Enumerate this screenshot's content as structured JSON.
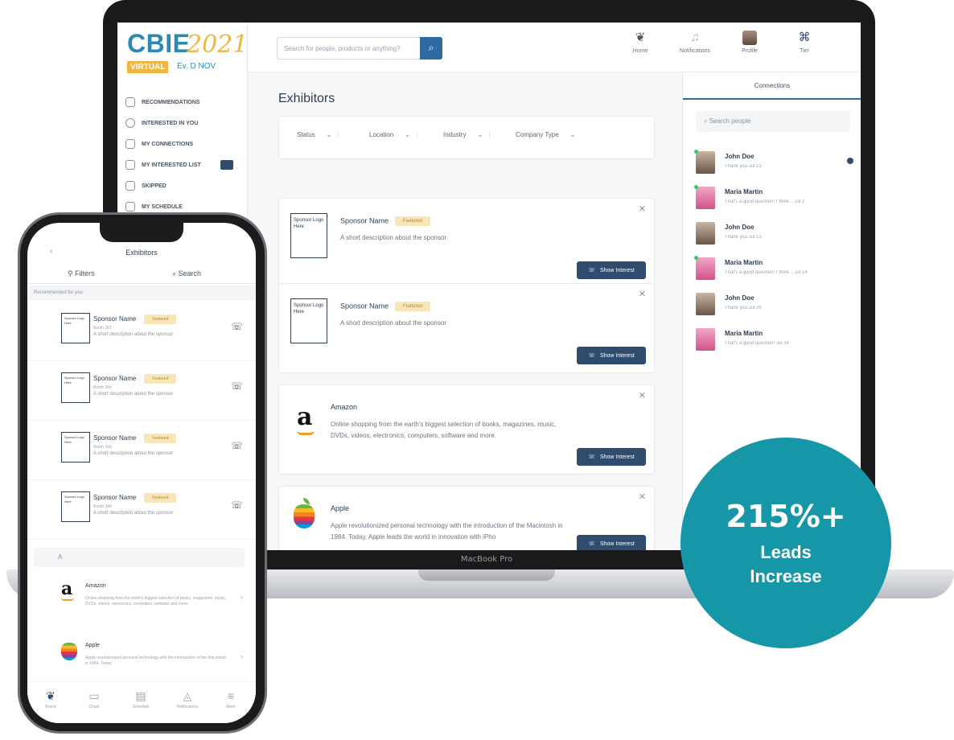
{
  "laptop": {
    "brand": "MacBook Pro",
    "logo": {
      "main": "CBIE",
      "year": "2021",
      "tag": "VIRTUAL",
      "date": "Ev. D NOV"
    },
    "sidebar_items": [
      {
        "label": "RECOMMENDATIONS",
        "icon": "star-icon"
      },
      {
        "label": "INTERESTED IN YOU",
        "icon": "smile-icon"
      },
      {
        "label": "MY CONNECTIONS",
        "icon": "people-icon"
      },
      {
        "label": "MY INTERESTED LIST",
        "icon": "thumb-icon"
      },
      {
        "label": "SKIPPED",
        "icon": "skip-icon"
      },
      {
        "label": "MY SCHEDULE",
        "icon": "calendar-icon"
      }
    ],
    "search_placeholder": "Search for people, products or anything?",
    "nav": [
      {
        "label": "Home",
        "icon": "home-icon"
      },
      {
        "label": "Notifications",
        "icon": "bell-icon"
      },
      {
        "label": "Profile",
        "icon": "avatar"
      },
      {
        "label": "Tier",
        "icon": "tier-icon"
      }
    ],
    "page_title": "Exhibitors",
    "filters": [
      "Status",
      "Location",
      "Industry",
      "Company Type"
    ],
    "cards": [
      {
        "logo_text": "Sponsor Logo Here",
        "name": "Sponsor Name",
        "badge": "Featured",
        "desc": "A short description about the sponsor",
        "button": "Show Interest"
      },
      {
        "logo_text": "Sponsor Logo Here",
        "name": "Sponsor Name",
        "badge": "Featured",
        "desc": "A short description about the sponsor",
        "button": "Show Interest"
      },
      {
        "name": "Amazon",
        "desc": "Online shopping from the earth's biggest selection of books, magazines, music, DVDs, videos, electronics, computers, software and more.",
        "button": "Show Interest"
      },
      {
        "name": "Apple",
        "desc": "Apple revolutionized personal technology with the introduction of the Macintosh in 1984. Today, Apple leads the world in innovation with iPho",
        "button": "Show Interest"
      }
    ],
    "connections": {
      "title": "Connections",
      "search_placeholder": "Search people",
      "people": [
        {
          "name": "John Doe",
          "msg": "Thank you  Jul 13",
          "unread": true
        },
        {
          "name": "Maria Martin",
          "msg": "That's a good question! I think...  Jul 2"
        },
        {
          "name": "John Doe",
          "msg": "Thank you  Jul 13"
        },
        {
          "name": "Maria Martin",
          "msg": "That's a good question! I think...  Jul 14"
        },
        {
          "name": "John Doe",
          "msg": "Thank you  Jul 09"
        },
        {
          "name": "Maria Martin",
          "msg": "That's a good question!  Jul 14"
        }
      ]
    }
  },
  "phone": {
    "title": "Exhibitors",
    "tabs": {
      "filters": "Filters",
      "search": "Search"
    },
    "section_label": "Recommended for you",
    "items": [
      {
        "logo_text": "Sponsor Logo Here",
        "name": "Sponsor Name",
        "badge": "Featured",
        "sub": "Booth 201",
        "desc": "A short description about the sponsor"
      },
      {
        "logo_text": "Sponsor Logo Here",
        "name": "Sponsor Name",
        "badge": "Featured",
        "sub": "Booth 3dd",
        "desc": "A short description about the sponsor"
      },
      {
        "logo_text": "Sponsor Logo Here",
        "name": "Sponsor Name",
        "badge": "Featured",
        "sub": "Booth 3dd",
        "desc": "A short description about the sponsor"
      },
      {
        "logo_text": "Sponsor Logo Here",
        "name": "Sponsor Name",
        "badge": "Featured",
        "sub": "Booth 3dd",
        "desc": "A short description about the sponsor"
      }
    ],
    "letter": "A",
    "companies": [
      {
        "name": "Amazon",
        "desc": "Online shopping from the earth's biggest selection of books, magazines, music, DVDs, videos, electronics, computers, software and more."
      },
      {
        "name": "Apple",
        "desc": "Apple revolutionized personal technology with the introduction of the Macintosh in 1984. Today,"
      }
    ],
    "bottom_nav": [
      {
        "label": "Brand",
        "icon": "home-icon",
        "active": true
      },
      {
        "label": "Chats",
        "icon": "chat-icon"
      },
      {
        "label": "Schedule",
        "icon": "calendar-icon"
      },
      {
        "label": "Notifications",
        "icon": "bell-icon"
      },
      {
        "label": "More",
        "icon": "menu-icon"
      }
    ]
  },
  "stat": {
    "value": "215%+",
    "line1": "Leads",
    "line2": "Increase"
  },
  "colors": {
    "accent": "#1597a8",
    "navy": "#2f4b6e",
    "badge": "#f8e6b8"
  }
}
